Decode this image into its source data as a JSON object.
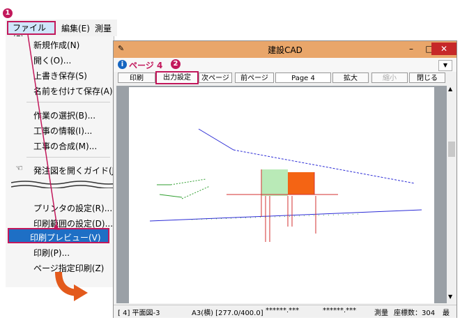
{
  "menubar": {
    "file": "ファイル(F)",
    "edit": "編集(E)",
    "survey": "測量"
  },
  "file_menu": {
    "items": [
      "新規作成(N)",
      "開く(O)...",
      "上書き保存(S)",
      "名前を付けて保存(A)...",
      "作業の選択(B)...",
      "工事の情報(I)...",
      "工事の合成(M)...",
      "発注図を開くガイド(J)...",
      "プリンタの設定(R)...",
      "印刷範囲の設定(D)...",
      "印刷プレビュー(V)",
      "印刷(P)...",
      "ページ指定印刷(Z)"
    ]
  },
  "window": {
    "title": "建設CAD",
    "page_label": "ページ 4",
    "info_icon": "i",
    "dropdown_arrow": "▼"
  },
  "toolbar": {
    "print": "印刷",
    "output_settings": "出力設定",
    "next_page": "次ページ",
    "prev_page": "前ページ",
    "page": "Page 4",
    "zoom_in": "拡大",
    "zoom_out": "縮小",
    "close": "閉じる"
  },
  "statusbar": {
    "drawing": "[ 4] 平面図-3",
    "paper": "A3(横) [277.0/400.0]",
    "coord_x": "******.***",
    "coord_y": "******.***",
    "mode": "測量",
    "point_count": "座標数：304",
    "last": "最"
  },
  "badges": {
    "one": "1",
    "two": "2"
  },
  "colors": {
    "accent": "#c2185b",
    "highlight": "#1e6fc5",
    "titlebar": "#e9a66a",
    "close": "#c62828",
    "arrow": "#e35a1c"
  }
}
